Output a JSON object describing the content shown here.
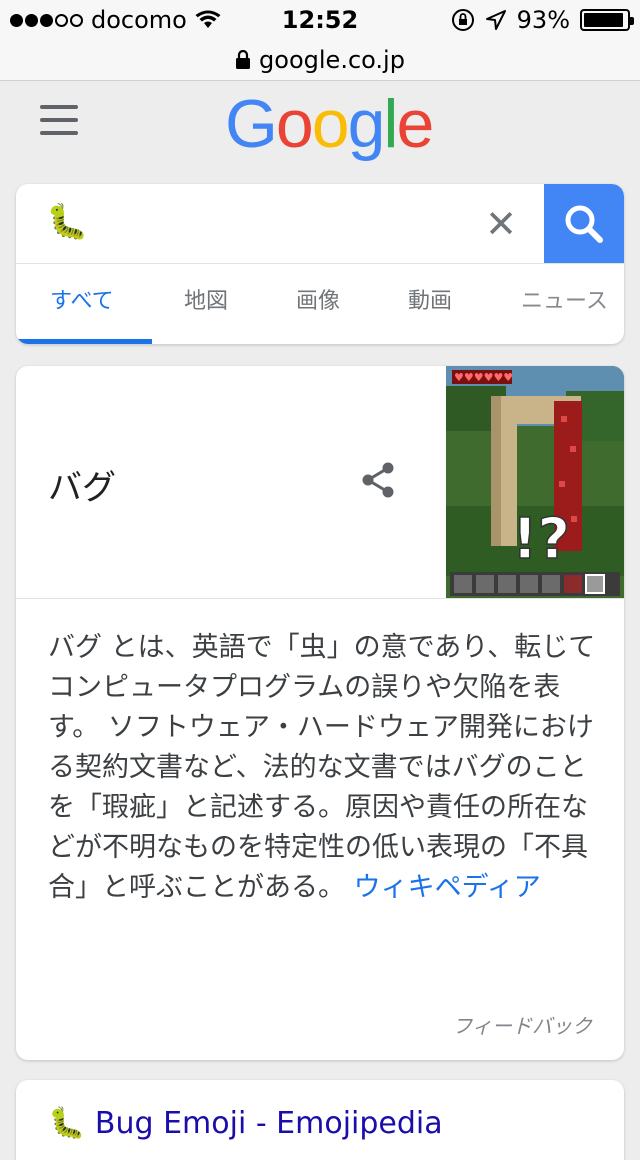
{
  "status_bar": {
    "carrier": "docomo",
    "signal_bars_filled": 3,
    "signal_bars_total": 5,
    "time": "12:52",
    "battery": "93%",
    "battery_level": 0.93
  },
  "url_bar": {
    "domain": "google.co.jp"
  },
  "header": {
    "logo_letters": [
      {
        "ch": "G",
        "color": "#4285f4"
      },
      {
        "ch": "o",
        "color": "#ea4335"
      },
      {
        "ch": "o",
        "color": "#fbbc05"
      },
      {
        "ch": "g",
        "color": "#4285f4"
      },
      {
        "ch": "l",
        "color": "#34a853"
      },
      {
        "ch": "e",
        "color": "#ea4335"
      }
    ]
  },
  "search": {
    "query": "🐛",
    "clear_symbol": "✕",
    "tabs": [
      {
        "label": "すべて",
        "active": true
      },
      {
        "label": "地図",
        "active": false
      },
      {
        "label": "画像",
        "active": false
      },
      {
        "label": "動画",
        "active": false
      },
      {
        "label": "ニュース",
        "active": false
      }
    ]
  },
  "knowledge_panel": {
    "title": "バグ",
    "image_overlay_text": "!?",
    "description": "バグ とは、英語で「虫」の意であり、転じてコンピュータプログラムの誤りや欠陥を表す。 ソフトウェア・ハードウェア開発における契約文書など、法的な文書ではバグのことを「瑕疵」と記述する。原因や責任の所在などが不明なものを特定性の低い表現の「不具合」と呼ぶことがある。",
    "source_link": "ウィキペディア",
    "feedback": "フィードバック"
  },
  "results": [
    {
      "icon": "🐛",
      "title": "Bug Emoji - Emojipedia"
    }
  ],
  "colors": {
    "accent_blue": "#1a73e8",
    "search_button": "#4285f4",
    "background": "#ededed"
  }
}
